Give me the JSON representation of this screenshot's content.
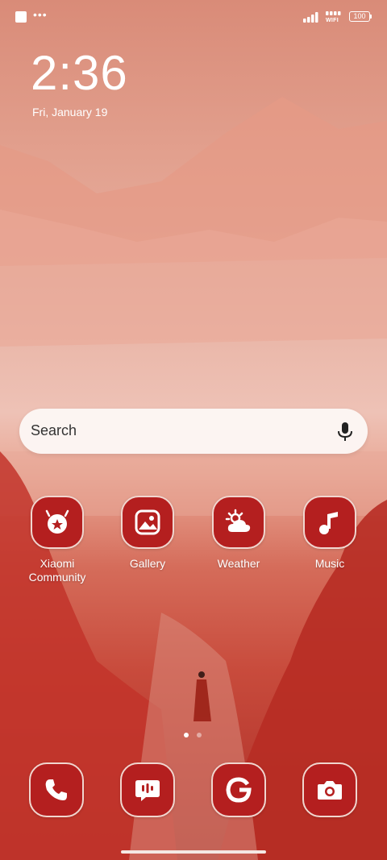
{
  "status_bar": {
    "battery_level": "100",
    "wifi_label": "WIFI",
    "overflow": "•••"
  },
  "lock": {
    "time": "2:36",
    "date": "Fri, January 19"
  },
  "search": {
    "placeholder": "Search"
  },
  "apps": [
    {
      "label": "Xiaomi Community",
      "icon": "xiaomi-community-icon"
    },
    {
      "label": "Gallery",
      "icon": "gallery-icon"
    },
    {
      "label": "Weather",
      "icon": "weather-icon"
    },
    {
      "label": "Music",
      "icon": "music-note-icon"
    }
  ],
  "pager": {
    "pages": 2,
    "current": 1
  },
  "dock": [
    {
      "name": "Phone",
      "icon": "phone-icon"
    },
    {
      "name": "Messages",
      "icon": "messages-icon"
    },
    {
      "name": "Google",
      "icon": "google-icon"
    },
    {
      "name": "Camera",
      "icon": "camera-icon"
    }
  ],
  "colors": {
    "icon_bg": "#b41f1f",
    "icon_border": "#f1d6cf",
    "search_bg": "#fcf7f5"
  }
}
